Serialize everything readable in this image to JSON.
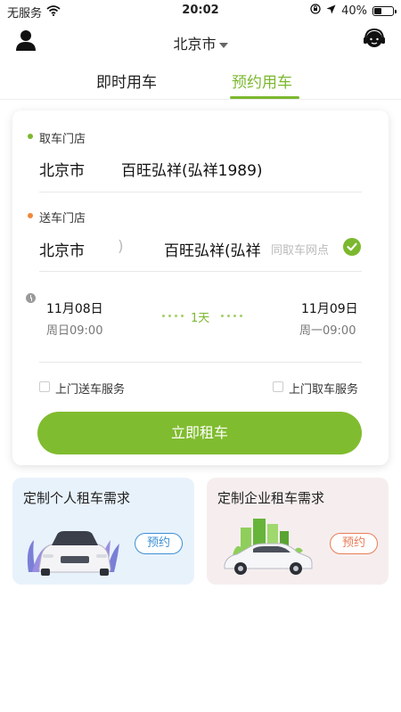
{
  "status_bar": {
    "carrier": "无服务",
    "time": "20:02",
    "battery": "40%",
    "battery_level": 0.4
  },
  "nav": {
    "city": "北京市"
  },
  "tabs": [
    {
      "label": "即时用车",
      "active": false
    },
    {
      "label": "预约用车",
      "active": true
    }
  ],
  "pickup": {
    "label": "取车门店",
    "city": "北京市",
    "store": "百旺弘祥(弘祥1989)"
  },
  "dropoff": {
    "label": "送车门店",
    "city": "北京市",
    "separator": ")",
    "store": "百旺弘祥(弘祥",
    "same_point_label": "同取车网点",
    "same_point_checked": true
  },
  "schedule": {
    "start_date": "11月08日",
    "start_time": "周日09:00",
    "duration": "1天",
    "end_date": "11月09日",
    "end_time": "周一09:00"
  },
  "options": {
    "delivery_service": "上门送车服务",
    "pickup_service": "上门取车服务"
  },
  "rent_button": "立即租车",
  "demand_cards": [
    {
      "title": "定制个人租车需求",
      "button": "预约"
    },
    {
      "title": "定制企业租车需求",
      "button": "预约"
    }
  ],
  "colors": {
    "accent": "#7cb82f",
    "personal_accent": "#3d8fd6",
    "enterprise_accent": "#e97c56",
    "pickup_dot": "#7cb82f",
    "dropoff_dot": "#f0873a"
  },
  "icons": [
    "wifi-icon",
    "lock-rotation-icon",
    "location-arrow-icon",
    "battery-icon",
    "user-icon",
    "customer-service-icon",
    "check-icon",
    "clock-icon"
  ]
}
